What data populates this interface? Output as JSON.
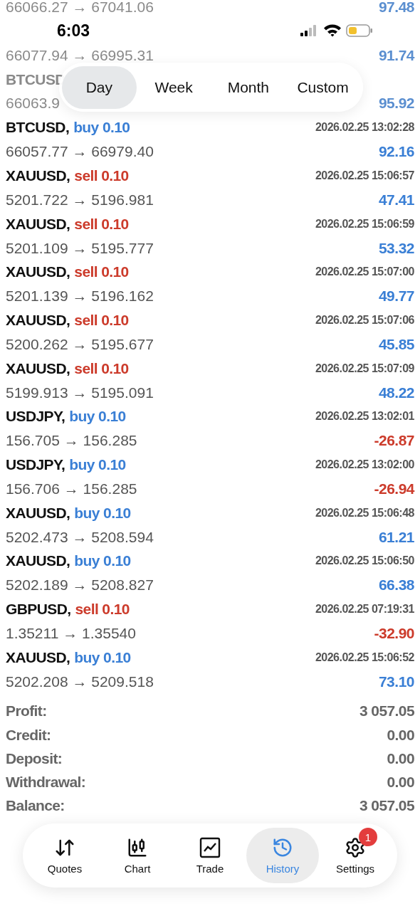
{
  "status_bar": {
    "time": "6:03"
  },
  "period_tabs": [
    {
      "label": "Day",
      "selected": true
    },
    {
      "label": "Week",
      "selected": false
    },
    {
      "label": "Month",
      "selected": false
    },
    {
      "label": "Custom",
      "selected": false
    }
  ],
  "faded_deals": [
    {
      "prices": "66066.27 → 67041.06",
      "profit": "97.48"
    },
    {
      "prices": "66077.94 → 66995.31",
      "profit": "91.74"
    },
    {
      "symbol": "BTCUSD",
      "prices": "66063.9",
      "profit": "95.92"
    }
  ],
  "deals": [
    {
      "symbol": "BTCUSD,",
      "order": {
        "text": "buy 0.10",
        "color": "#3a7fd5"
      },
      "time": "2026.02.25 13:02:28",
      "prices": "66057.77 → 66979.40",
      "profit": {
        "text": "92.16",
        "color": "#3a7fd5"
      }
    },
    {
      "symbol": "XAUUSD,",
      "order": {
        "text": "sell 0.10",
        "color": "#cc3b2b"
      },
      "time": "2026.02.25 15:06:57",
      "prices": "5201.722 → 5196.981",
      "profit": {
        "text": "47.41",
        "color": "#3a7fd5"
      }
    },
    {
      "symbol": "XAUUSD,",
      "order": {
        "text": "sell 0.10",
        "color": "#cc3b2b"
      },
      "time": "2026.02.25 15:06:59",
      "prices": "5201.109 → 5195.777",
      "profit": {
        "text": "53.32",
        "color": "#3a7fd5"
      }
    },
    {
      "symbol": "XAUUSD,",
      "order": {
        "text": "sell 0.10",
        "color": "#cc3b2b"
      },
      "time": "2026.02.25 15:07:00",
      "prices": "5201.139 → 5196.162",
      "profit": {
        "text": "49.77",
        "color": "#3a7fd5"
      }
    },
    {
      "symbol": "XAUUSD,",
      "order": {
        "text": "sell 0.10",
        "color": "#cc3b2b"
      },
      "time": "2026.02.25 15:07:06",
      "prices": "5200.262 → 5195.677",
      "profit": {
        "text": "45.85",
        "color": "#3a7fd5"
      }
    },
    {
      "symbol": "XAUUSD,",
      "order": {
        "text": "sell 0.10",
        "color": "#cc3b2b"
      },
      "time": "2026.02.25 15:07:09",
      "prices": "5199.913 → 5195.091",
      "profit": {
        "text": "48.22",
        "color": "#3a7fd5"
      }
    },
    {
      "symbol": "USDJPY,",
      "order": {
        "text": "buy 0.10",
        "color": "#3a7fd5"
      },
      "time": "2026.02.25 13:02:01",
      "prices": "156.705 → 156.285",
      "profit": {
        "text": "-26.87",
        "color": "#cc3b2b"
      }
    },
    {
      "symbol": "USDJPY,",
      "order": {
        "text": "buy 0.10",
        "color": "#3a7fd5"
      },
      "time": "2026.02.25 13:02:00",
      "prices": "156.706 → 156.285",
      "profit": {
        "text": "-26.94",
        "color": "#cc3b2b"
      }
    },
    {
      "symbol": "XAUUSD,",
      "order": {
        "text": "buy 0.10",
        "color": "#3a7fd5"
      },
      "time": "2026.02.25 15:06:48",
      "prices": "5202.473 → 5208.594",
      "profit": {
        "text": "61.21",
        "color": "#3a7fd5"
      }
    },
    {
      "symbol": "XAUUSD,",
      "order": {
        "text": "buy 0.10",
        "color": "#3a7fd5"
      },
      "time": "2026.02.25 15:06:50",
      "prices": "5202.189 → 5208.827",
      "profit": {
        "text": "66.38",
        "color": "#3a7fd5"
      }
    },
    {
      "symbol": "GBPUSD,",
      "order": {
        "text": "sell 0.10",
        "color": "#cc3b2b"
      },
      "time": "2026.02.25 07:19:31",
      "prices": "1.35211 → 1.35540",
      "profit": {
        "text": "-32.90",
        "color": "#cc3b2b"
      }
    },
    {
      "symbol": "XAUUSD,",
      "order": {
        "text": "buy 0.10",
        "color": "#3a7fd5"
      },
      "time": "2026.02.25 15:06:52",
      "prices": "5202.208 → 5209.518",
      "profit": {
        "text": "73.10",
        "color": "#3a7fd5"
      }
    }
  ],
  "summary": [
    {
      "label": "Profit:",
      "value": "3 057.05"
    },
    {
      "label": "Credit:",
      "value": "0.00"
    },
    {
      "label": "Deposit:",
      "value": "0.00"
    },
    {
      "label": "Withdrawal:",
      "value": "0.00"
    },
    {
      "label": "Balance:",
      "value": "3 057.05"
    }
  ],
  "tab_bar": [
    {
      "kind": "quotes",
      "label": "Quotes",
      "selected": false
    },
    {
      "kind": "chart",
      "label": "Chart",
      "selected": false
    },
    {
      "kind": "trade",
      "label": "Trade",
      "selected": false
    },
    {
      "kind": "history",
      "label": "History",
      "selected": true
    },
    {
      "kind": "settings",
      "label": "Settings",
      "selected": false,
      "badge": "1"
    }
  ]
}
